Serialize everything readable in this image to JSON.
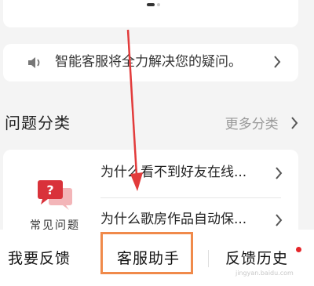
{
  "banner": {
    "pager": {
      "count": 2,
      "active": 1
    }
  },
  "notice": {
    "text": "智能客服将全力解决您的疑问。",
    "icon": "speaker-icon"
  },
  "section": {
    "title": "问题分类",
    "more_label": "更多分类"
  },
  "faq": {
    "category_label": "常见问题",
    "items": [
      {
        "question": "为什么看不到好友在线..."
      },
      {
        "question": "为什么歌房作品自动保..."
      }
    ]
  },
  "tabs": [
    {
      "label": "我要反馈"
    },
    {
      "label": "客服助手",
      "highlighted": true
    },
    {
      "label": "反馈历史",
      "badge": "red-dot"
    }
  ],
  "watermark": "jingyan.baidu.com",
  "colors": {
    "highlight": "#f08a4b",
    "badge": "#e5262a",
    "arrow": "#e23b3b",
    "icon": "#d9323a"
  }
}
